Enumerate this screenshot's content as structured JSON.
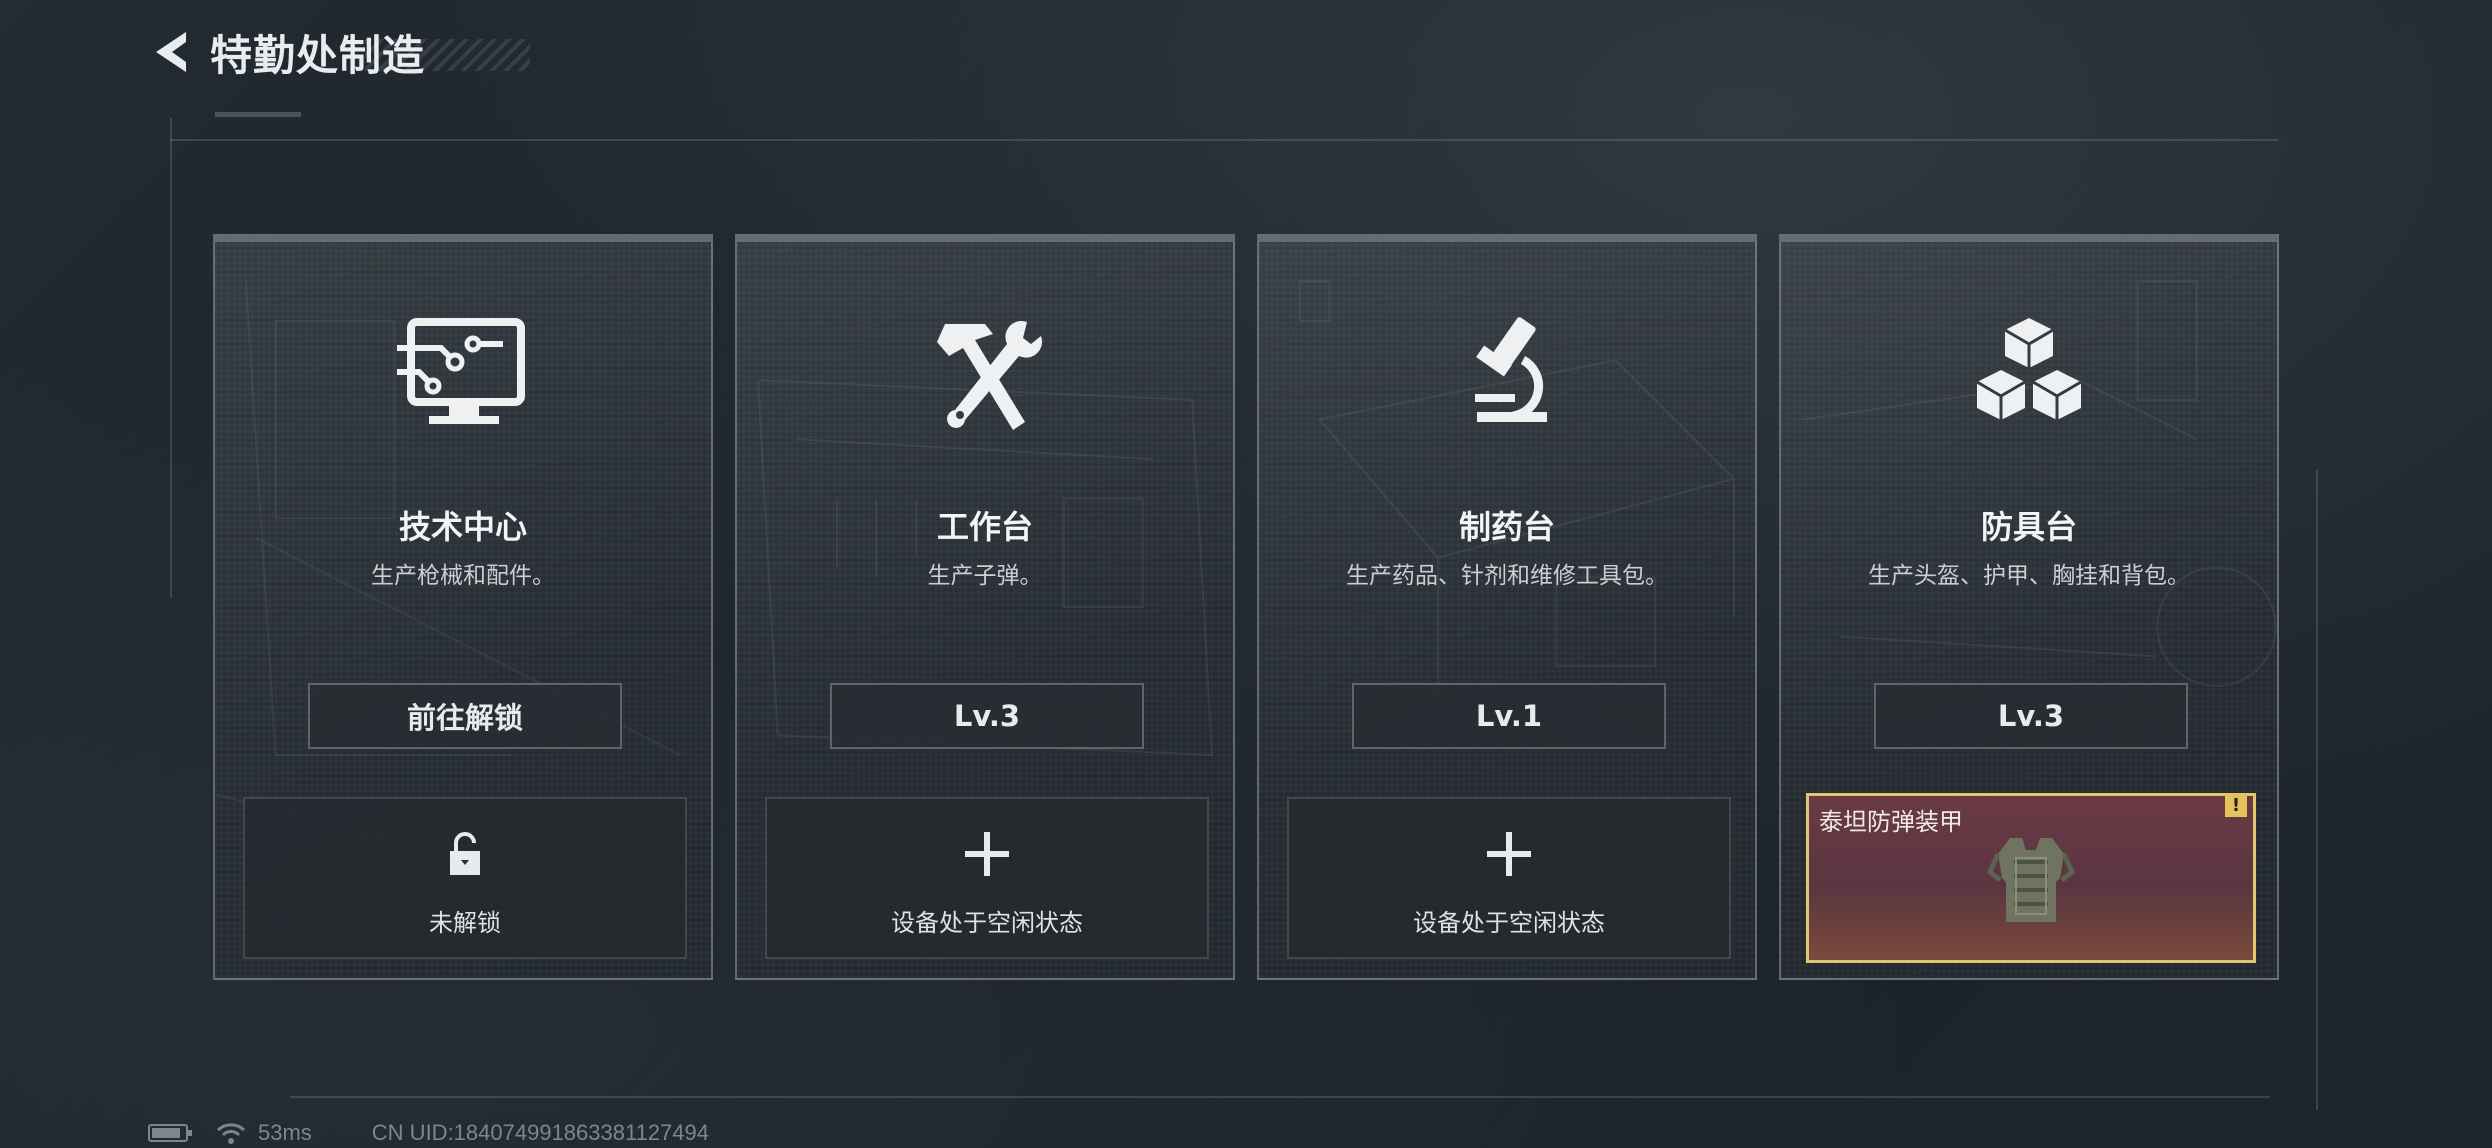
{
  "header": {
    "title": "特勤处制造"
  },
  "cards": [
    {
      "title": "技术中心",
      "desc": "生产枪械和配件。",
      "button": "前往解锁",
      "slot_label": "未解锁"
    },
    {
      "title": "工作台",
      "desc": "生产子弹。",
      "button": "Lv.3",
      "slot_label": "设备处于空闲状态"
    },
    {
      "title": "制药台",
      "desc": "生产药品、针剂和维修工具包。",
      "button": "Lv.1",
      "slot_label": "设备处于空闲状态"
    },
    {
      "title": "防具台",
      "desc": "生产头盔、护甲、胸挂和背包。",
      "button": "Lv.3",
      "slot_item_name": "泰坦防弹装甲",
      "slot_alert": "!"
    }
  ],
  "status_bar": {
    "ping": "53ms",
    "uid": "CN UID:184074991863381127494"
  },
  "colors": {
    "background": "#1b2128",
    "accent_gold": "#e0c870",
    "item_slot_bg": "#5a3540"
  },
  "icons": [
    "back-arrow-icon",
    "computer-circuit-icon",
    "hammer-wrench-icon",
    "microscope-icon",
    "cubes-icon",
    "lock-icon",
    "plus-icon",
    "battery-icon",
    "wifi-icon"
  ]
}
